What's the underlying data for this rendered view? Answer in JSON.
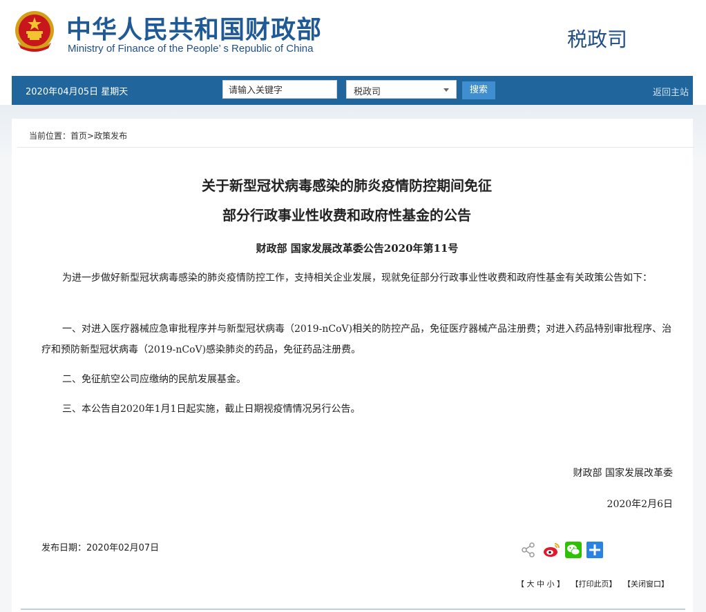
{
  "header": {
    "title_cn": "中华人民共和国财政部",
    "title_en": "Ministry of Finance of the People’ s Republic of China",
    "dept": "税政司",
    "emblem_icon": "national-emblem-icon"
  },
  "nav": {
    "date": "2020年04月05日  星期天",
    "search_placeholder": "请输入关键字",
    "select_value": "税政司",
    "search_label": "搜索",
    "home_label": "返回主站"
  },
  "breadcrumb": {
    "prefix": "当前位置：",
    "home": "首页",
    "sep": ">",
    "section": "政策发布"
  },
  "article": {
    "title_line1": "关于新型冠状病毒感染的肺炎疫情防控期间免征",
    "title_line2": "部分行政事业性收费和政府性基金的公告",
    "doc_no": "财政部  国家发展改革委公告2020年第11号",
    "p1": "为进一步做好新型冠状病毒感染的肺炎疫情防控工作，支持相关企业发展，现就免征部分行政事业性收费和政府性基金有关政策公告如下：",
    "p2": "一、对进入医疗器械应急审批程序并与新型冠状病毒（2019-nCoV)相关的防控产品，免征医疗器械产品注册费；对进入药品特别审批程序、治疗和预防新型冠状病毒（2019-nCoV)感染肺炎的药品，免征药品注册费。",
    "p3": "二、免征航空公司应缴纳的民航发展基金。",
    "p4": "三、本公告自2020年1月1日起实施，截止日期视疫情情况另行公告。",
    "signers": "财政部    国家发展改革委",
    "sign_date": "2020年2月6日"
  },
  "footer": {
    "pub_date": "发布日期：2020年02月07日",
    "font_size_label": "【 大 中 小 】",
    "print_label": "【打印此页】",
    "close_label": "【关闭窗口】",
    "share_icons": [
      "share-icon",
      "weibo-icon",
      "wechat-icon",
      "add-share-icon"
    ]
  },
  "colors": {
    "brand_blue": "#1f5a96",
    "nav_bg": "#20659b",
    "search_btn": "#3f8fd0",
    "weibo_red": "#e6162d",
    "wechat_green": "#2dc100",
    "plus_blue": "#2a82e4"
  }
}
